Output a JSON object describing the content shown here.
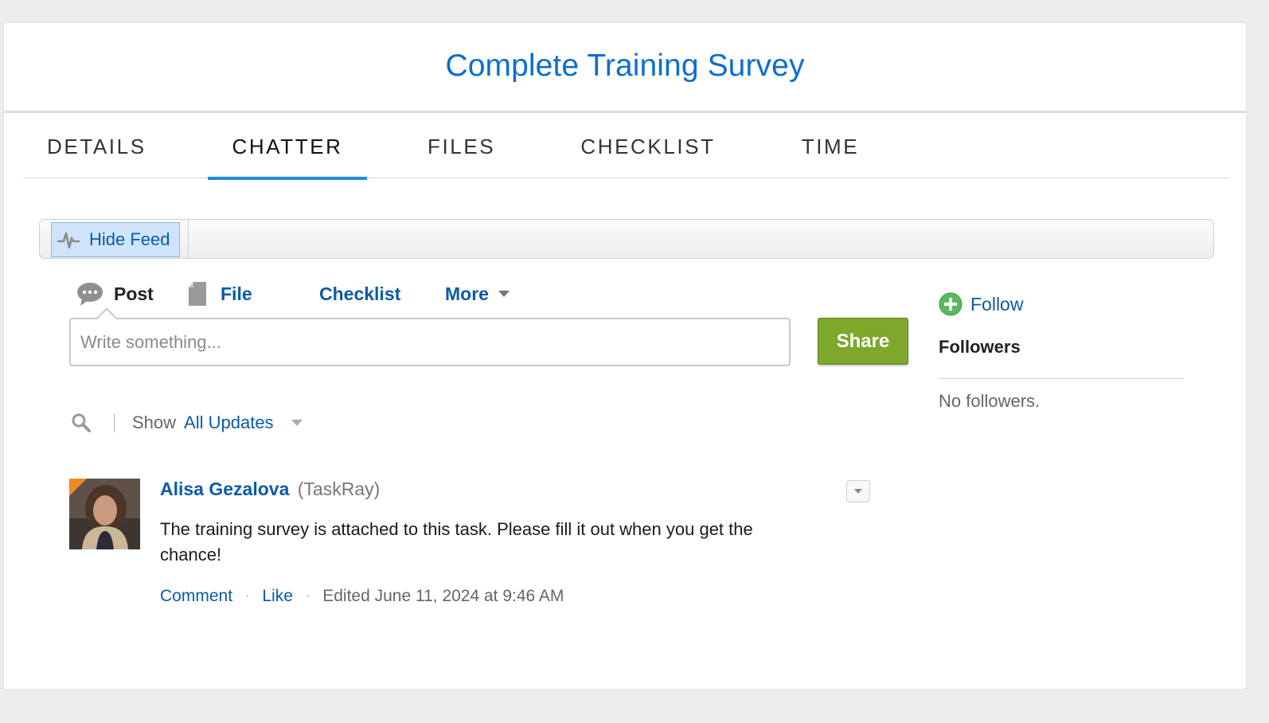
{
  "page": {
    "title": "Complete Training Survey"
  },
  "tabs": [
    {
      "label": "DETAILS",
      "active": false
    },
    {
      "label": "CHATTER",
      "active": true
    },
    {
      "label": "FILES",
      "active": false
    },
    {
      "label": "CHECKLIST",
      "active": false
    },
    {
      "label": "TIME",
      "active": false
    }
  ],
  "feed_bar": {
    "hide_feed_label": "Hide Feed",
    "icon": "pulse-icon"
  },
  "publisher": {
    "tabs": [
      {
        "label": "Post",
        "icon": "speech-bubble-icon"
      },
      {
        "label": "File",
        "icon": "document-icon"
      },
      {
        "label": "Checklist"
      },
      {
        "label": "More",
        "icon": "caret-down-icon"
      }
    ],
    "composer_placeholder": "Write something...",
    "share_label": "Share"
  },
  "filter": {
    "show_label": "Show",
    "selected": "All Updates"
  },
  "post": {
    "author": "Alisa Gezalova",
    "org": "(TaskRay)",
    "body": "The training survey is attached to this task. Please fill it out when you get the chance!",
    "actions": {
      "comment": "Comment",
      "like": "Like",
      "separator": "·",
      "meta": "Edited June 11, 2024 at 9:46 AM"
    }
  },
  "sidebar": {
    "follow_label": "Follow",
    "followers_title": "Followers",
    "no_followers": "No followers."
  },
  "colors": {
    "link": "#0b5aa8",
    "title": "#0b6ed0",
    "tab_underline": "#1b8ce8",
    "share_button": "#7ea82a",
    "follow_plus": "#5cb85c"
  }
}
